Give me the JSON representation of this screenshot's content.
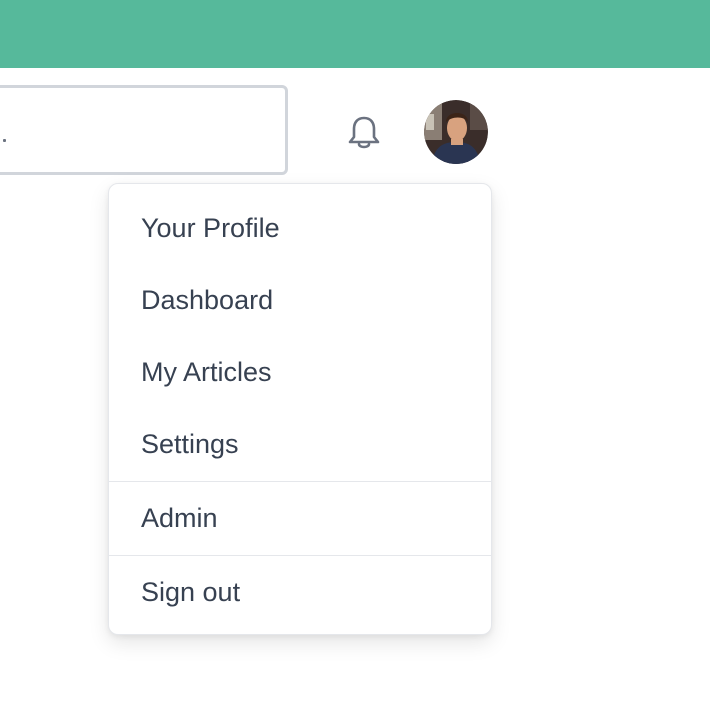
{
  "header": {
    "accent_color": "#56b99b"
  },
  "search": {
    "value": "",
    "icon": "search-icon"
  },
  "notifications": {
    "icon": "bell-icon"
  },
  "user": {
    "avatar_icon": "user-avatar"
  },
  "menu": {
    "items": [
      {
        "label": "Your Profile"
      },
      {
        "label": "Dashboard"
      },
      {
        "label": "My Articles"
      },
      {
        "label": "Settings"
      },
      {
        "label": "Admin"
      },
      {
        "label": "Sign out"
      }
    ]
  }
}
